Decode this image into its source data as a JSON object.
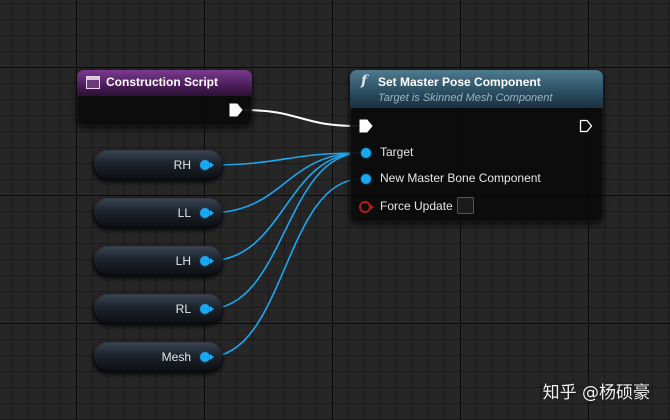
{
  "construction_script": {
    "title": "Construction Script"
  },
  "set_master_pose": {
    "title": "Set Master Pose Component",
    "subtitle": "Target is Skinned Mesh Component",
    "pins": {
      "target": "Target",
      "new_master_bone": "New Master Bone Component",
      "force_update": "Force Update"
    },
    "force_update_checked": false
  },
  "variables": [
    "RH",
    "LL",
    "LH",
    "RL",
    "Mesh"
  ],
  "colors": {
    "data_wire": "#1aa8f0",
    "exec_wire": "#ffffff",
    "bool_pin": "#b01c1c",
    "construction_header": "#4b1e5a",
    "function_header": "#2d4f62"
  },
  "watermark": "知乎 @杨硕豪"
}
